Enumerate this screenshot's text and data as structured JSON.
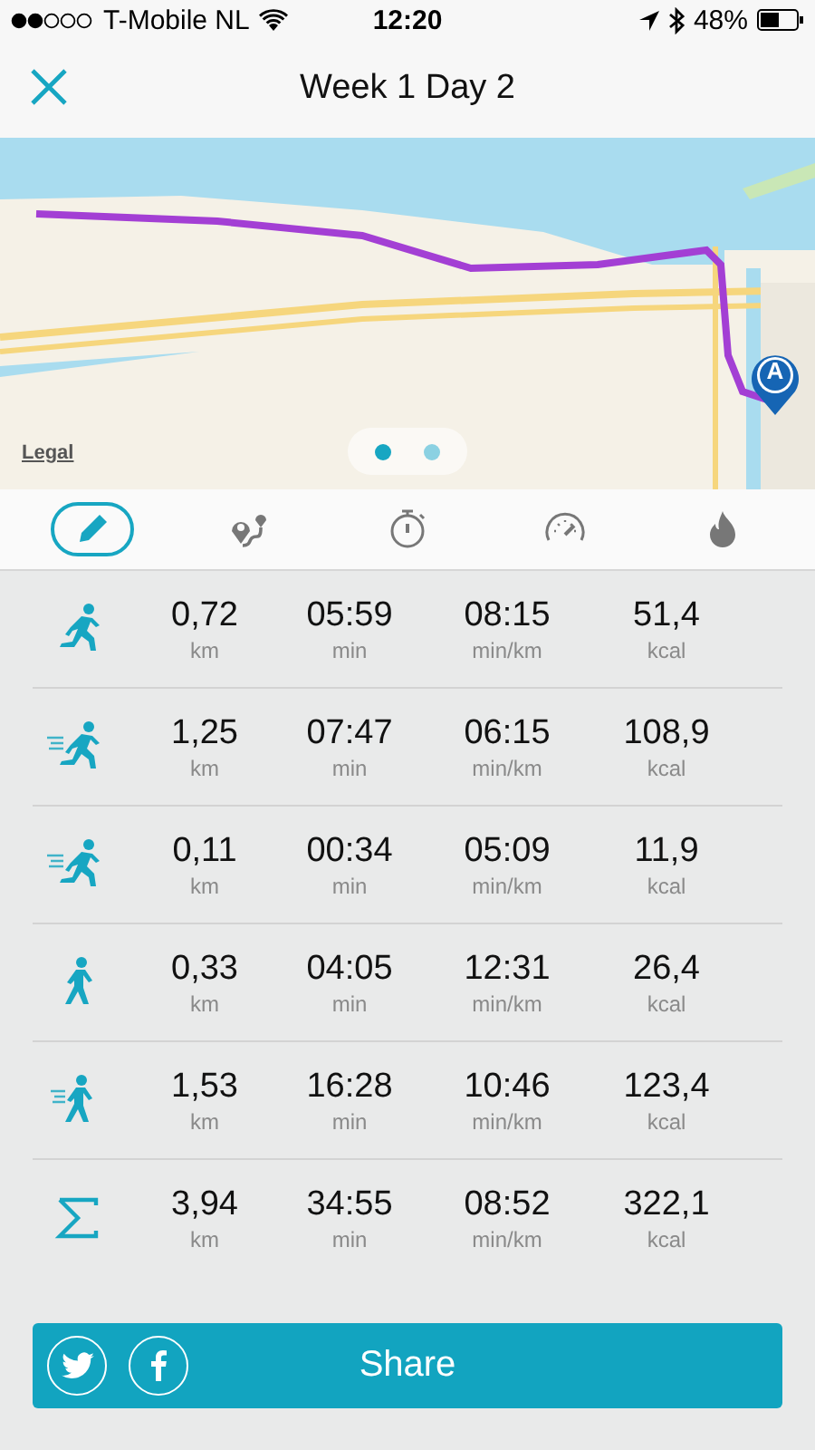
{
  "status_bar": {
    "carrier": "T-Mobile NL",
    "time": "12:20",
    "battery": "48%"
  },
  "nav": {
    "title": "Week 1 Day 2"
  },
  "map": {
    "kind": "picture",
    "legal": "Legal",
    "pin_label": "A",
    "pages": [
      {
        "selected": true
      },
      {
        "selected": false
      }
    ]
  },
  "tabs": [
    {
      "kind": "edit",
      "selected": true
    },
    {
      "kind": "route",
      "selected": false
    },
    {
      "kind": "time",
      "selected": false
    },
    {
      "kind": "speed",
      "selected": false
    },
    {
      "kind": "calories",
      "selected": false
    }
  ],
  "rows": [
    {
      "kind": "run",
      "distance": "0,72",
      "distance_unit": "km",
      "duration": "05:59",
      "duration_unit": "min",
      "pace": "08:15",
      "pace_unit": "min/km",
      "energy": "51,4",
      "energy_unit": "kcal"
    },
    {
      "kind": "fast-run",
      "distance": "1,25",
      "distance_unit": "km",
      "duration": "07:47",
      "duration_unit": "min",
      "pace": "06:15",
      "pace_unit": "min/km",
      "energy": "108,9",
      "energy_unit": "kcal"
    },
    {
      "kind": "fast-run",
      "distance": "0,11",
      "distance_unit": "km",
      "duration": "00:34",
      "duration_unit": "min",
      "pace": "05:09",
      "pace_unit": "min/km",
      "energy": "11,9",
      "energy_unit": "kcal"
    },
    {
      "kind": "walk",
      "distance": "0,33",
      "distance_unit": "km",
      "duration": "04:05",
      "duration_unit": "min",
      "pace": "12:31",
      "pace_unit": "min/km",
      "energy": "26,4",
      "energy_unit": "kcal"
    },
    {
      "kind": "fast-walk",
      "distance": "1,53",
      "distance_unit": "km",
      "duration": "16:28",
      "duration_unit": "min",
      "pace": "10:46",
      "pace_unit": "min/km",
      "energy": "123,4",
      "energy_unit": "kcal"
    },
    {
      "kind": "total",
      "distance": "3,94",
      "distance_unit": "km",
      "duration": "34:55",
      "duration_unit": "min",
      "pace": "08:52",
      "pace_unit": "min/km",
      "energy": "322,1",
      "energy_unit": "kcal"
    }
  ],
  "share": {
    "label": "Share"
  }
}
